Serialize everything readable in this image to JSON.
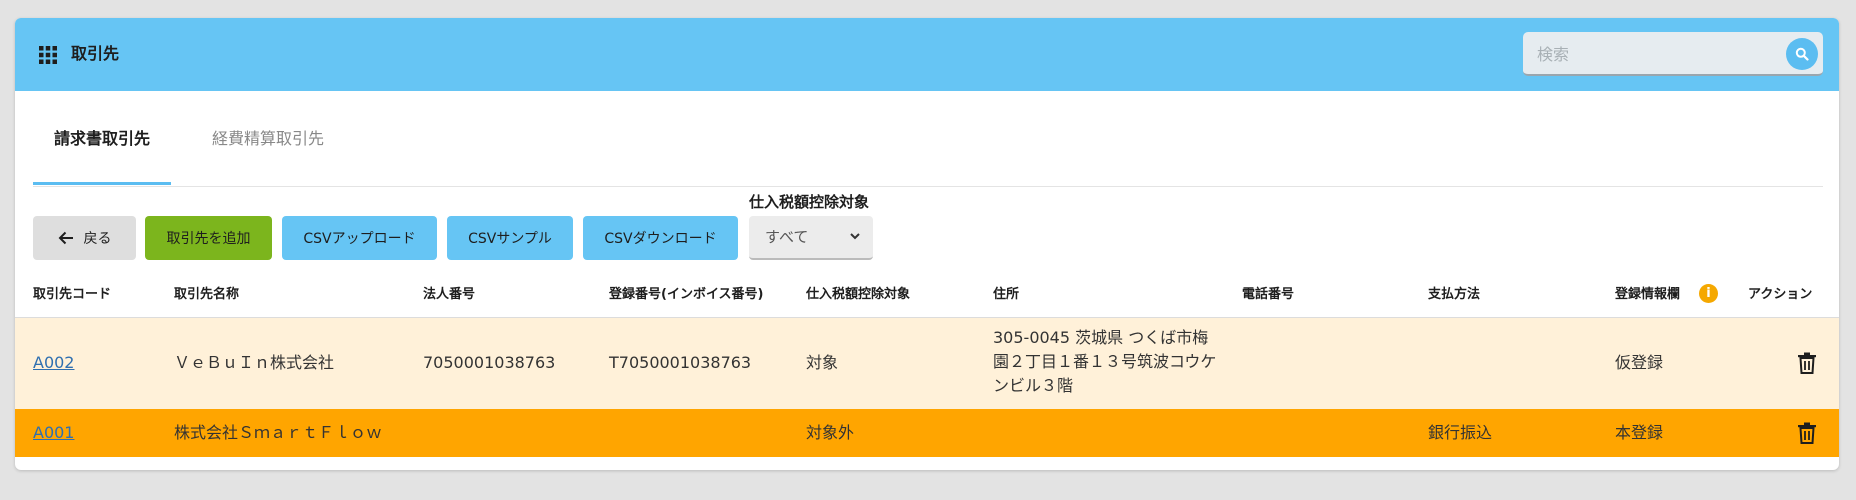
{
  "header": {
    "title": "取引先",
    "search_placeholder": "検索",
    "search_value": ""
  },
  "tabs": [
    {
      "label": "請求書取引先",
      "active": true
    },
    {
      "label": "経費精算取引先",
      "active": false
    }
  ],
  "toolbar": {
    "back_label": "戻る",
    "add_label": "取引先を追加",
    "csv_upload_label": "CSVアップロード",
    "csv_sample_label": "CSVサンプル",
    "csv_download_label": "CSVダウンロード"
  },
  "filter": {
    "label": "仕入税額控除対象",
    "selected": "すべて"
  },
  "table": {
    "columns": [
      "取引先コード",
      "取引先名称",
      "法人番号",
      "登録番号(インボイス番号)",
      "仕入税額控除対象",
      "住所",
      "電話番号",
      "支払方法",
      "登録情報欄",
      "アクション"
    ],
    "info_icon_glyph": "i",
    "rows": [
      {
        "code": "A002",
        "name": "ＶｅＢｕＩｎ株式会社",
        "corporate_number": "7050001038763",
        "registration_number": "T7050001038763",
        "tax_deduction": "対象",
        "address": "305-0045 茨城県 つくば市梅園２丁目１番１３号筑波コウケンビル３階",
        "phone": "",
        "payment_method": "",
        "registration_status": "仮登録"
      },
      {
        "code": "A001",
        "name": "株式会社ＳｍａｒｔＦｌｏｗ",
        "corporate_number": "",
        "registration_number": "",
        "tax_deduction": "対象外",
        "address": "",
        "phone": "",
        "payment_method": "銀行振込",
        "registration_status": "本登録"
      }
    ]
  },
  "colors": {
    "header_bg": "#66c5f4",
    "accent_blue": "#66c5f4",
    "add_button_green": "#7cb51d",
    "row_pending_bg": "#fff1d9",
    "row_highlight_bg": "#ffa500",
    "info_icon": "#f5a800",
    "link": "#2f6fb0"
  },
  "icons": {
    "app_menu": "grid-icon",
    "search": "search-icon",
    "back": "arrow-left-icon",
    "select": "chevron-down-icon",
    "info": "info-icon",
    "delete": "trash-icon"
  }
}
